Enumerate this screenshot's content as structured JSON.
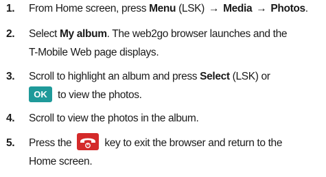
{
  "steps": [
    {
      "number": "1.",
      "lines": [
        [
          {
            "t": "From Home screen, press "
          },
          {
            "t": "Menu",
            "b": true
          },
          {
            "t": " (LSK) "
          },
          {
            "t": "→",
            "b": true
          },
          {
            "t": " "
          },
          {
            "t": "Media",
            "b": true
          },
          {
            "t": "  "
          },
          {
            "t": "→",
            "b": true
          },
          {
            "t": " "
          },
          {
            "t": "Photos",
            "b": true
          },
          {
            "t": "."
          }
        ]
      ]
    },
    {
      "number": "2.",
      "lines": [
        [
          {
            "t": "Select "
          },
          {
            "t": "My album",
            "b": true
          },
          {
            "t": ". The web2go browser launches and the"
          }
        ],
        [
          {
            "t": "T-Mobile Web page displays."
          }
        ]
      ]
    },
    {
      "number": "3.",
      "lines": [
        [
          {
            "t": "Scroll to highlight an album and press "
          },
          {
            "t": "Select",
            "b": true
          },
          {
            "t": " (LSK) or"
          }
        ],
        [
          {
            "key": "ok"
          },
          {
            "t": "to view the photos."
          }
        ]
      ]
    },
    {
      "number": "4.",
      "lines": [
        [
          {
            "t": "Scroll to view the photos in the album."
          }
        ]
      ]
    },
    {
      "number": "5.",
      "lines": [
        [
          {
            "t": "Press the"
          },
          {
            "key": "end"
          },
          {
            "t": "key to exit the browser and return to the"
          }
        ],
        [
          {
            "t": "Home screen."
          }
        ]
      ]
    }
  ],
  "keys": {
    "ok": {
      "label": "OK",
      "icon": "ok-key-icon",
      "color": "#1f9a9a"
    },
    "end": {
      "label": "",
      "icon": "end-call-key-icon",
      "color": "#d42a2a"
    }
  }
}
